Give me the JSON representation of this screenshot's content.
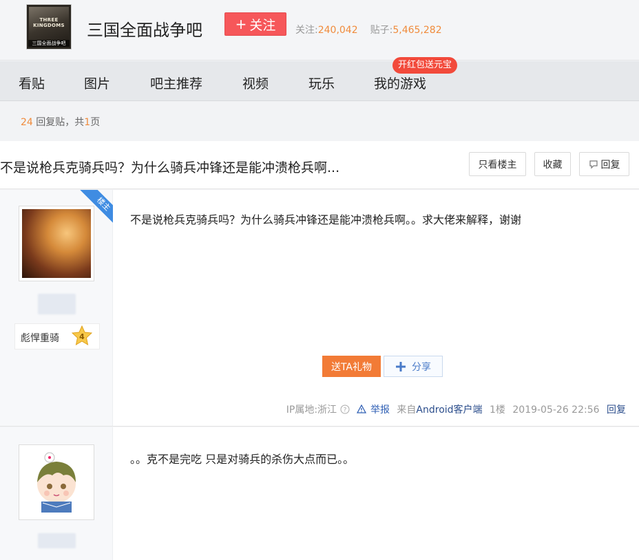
{
  "header": {
    "logo_text": "THREE KINGDOMS",
    "logo_sub": "三国全面战争吧",
    "forum_title": "三国全面战争吧",
    "follow_label": "关注",
    "followers_label": "关注:",
    "followers_value": "240,042",
    "posts_label": "贴子:",
    "posts_value": "5,465,282",
    "accent": "#f6575a"
  },
  "nav": {
    "items": [
      "看贴",
      "图片",
      "吧主推荐",
      "视频",
      "玩乐",
      "我的游戏"
    ],
    "badge": "开红包送元宝"
  },
  "reply_bar": {
    "count": "24",
    "count_suffix": "回复贴，共",
    "pages": "1",
    "pages_suffix": "页"
  },
  "thread": {
    "title": "不是说枪兵克骑兵吗？为什么骑兵冲锋还是能冲溃枪兵啊...",
    "only_op": "只看楼主",
    "favorite": "收藏",
    "reply": "回复"
  },
  "posts": [
    {
      "corner_tag": "楼主",
      "level_name": "彪悍重骑",
      "level": "4",
      "content": "不是说枪兵克骑兵吗？为什么骑兵冲锋还是能冲溃枪兵啊。。求大佬来解释，谢谢",
      "gift_label": "送TA礼物",
      "share_label": "分享",
      "ip_location": "IP属地:浙江",
      "report": "举报",
      "source": "来自",
      "client": "Android客户端",
      "floor": "1楼",
      "time": "2019-05-26 22:56",
      "reply": "回复"
    },
    {
      "content": "。。克不是完吃 只是对骑兵的杀伤大点而已。。"
    }
  ]
}
